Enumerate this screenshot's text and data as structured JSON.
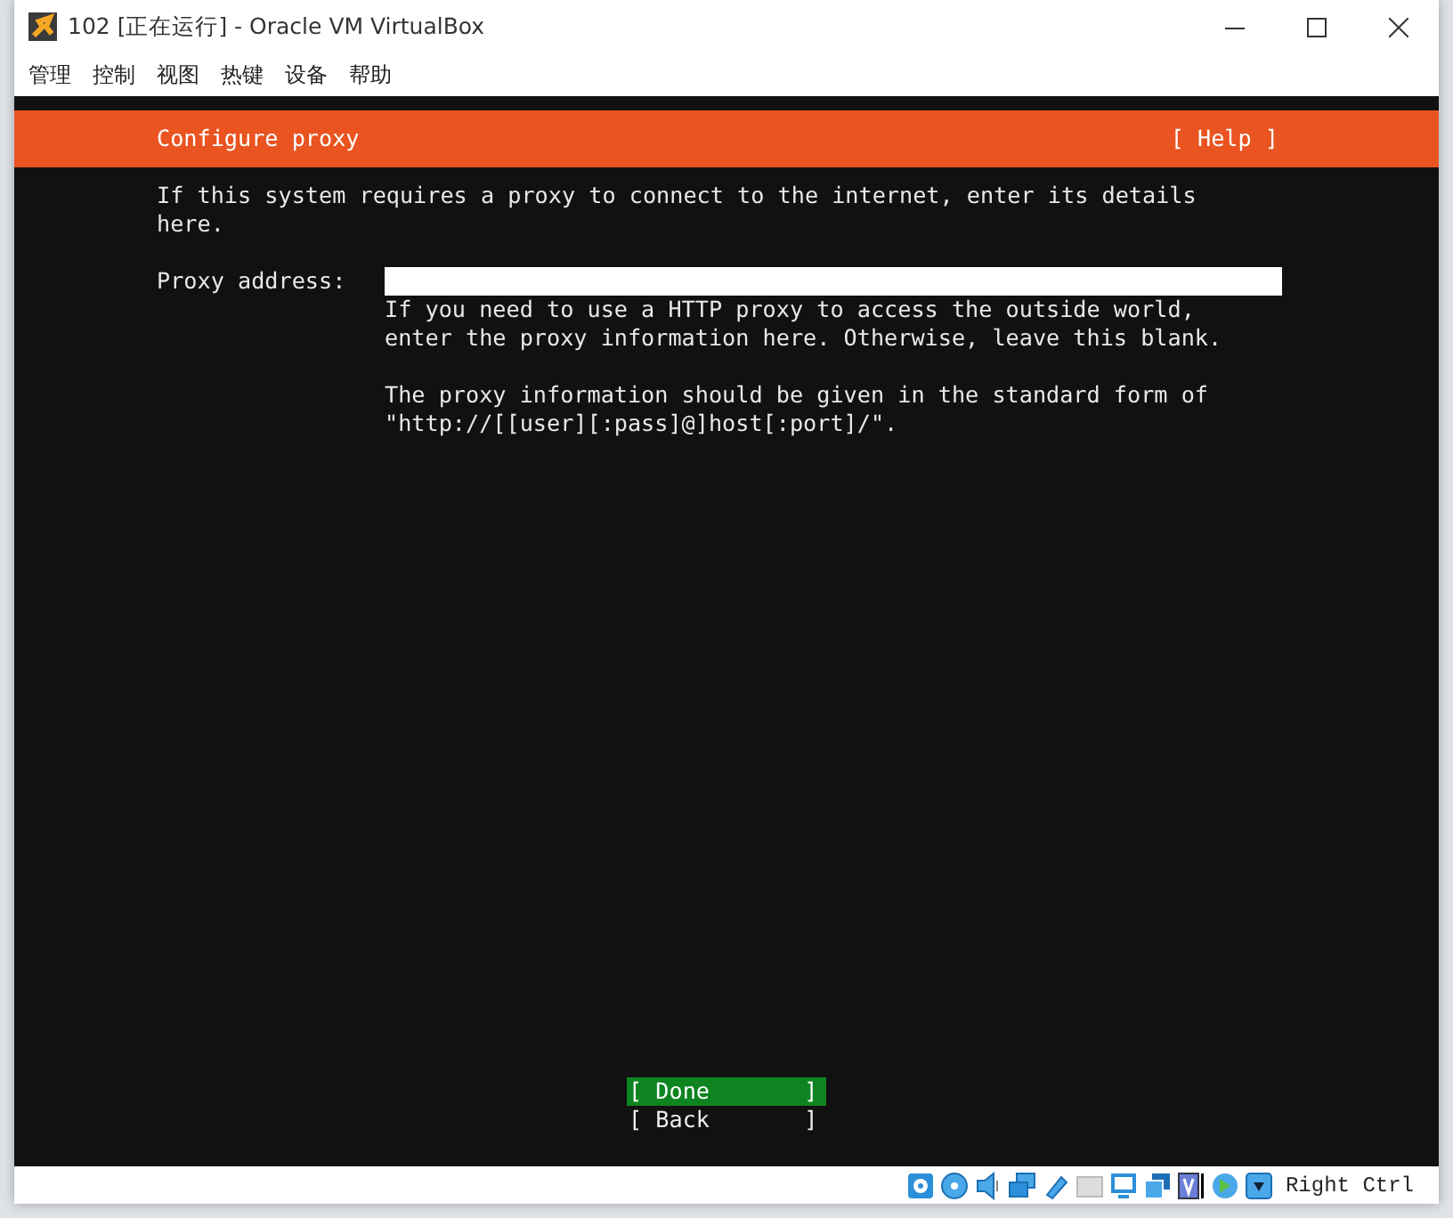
{
  "window": {
    "title": "102 [正在运行] - Oracle VM VirtualBox"
  },
  "menu": [
    "管理",
    "控制",
    "视图",
    "热键",
    "设备",
    "帮助"
  ],
  "screen": {
    "header": {
      "title": "Configure proxy",
      "help": "[ Help ]"
    },
    "intro": [
      "If this system requires a proxy to connect to the internet, enter its details",
      "here."
    ],
    "field": {
      "label": "Proxy address:"
    },
    "help_paragraphs": [
      [
        "If you need to use a HTTP proxy to access the outside world,",
        "enter the proxy information here. Otherwise, leave this blank."
      ],
      [
        "The proxy information should be given in the standard form of",
        "\"http://[[user][:pass]@]host[:port]/\"."
      ]
    ],
    "buttons": [
      {
        "label": "[ Done       ]",
        "selected": true
      },
      {
        "label": "[ Back       ]",
        "selected": false
      }
    ]
  },
  "status_bar": {
    "host_key": "Right Ctrl"
  }
}
